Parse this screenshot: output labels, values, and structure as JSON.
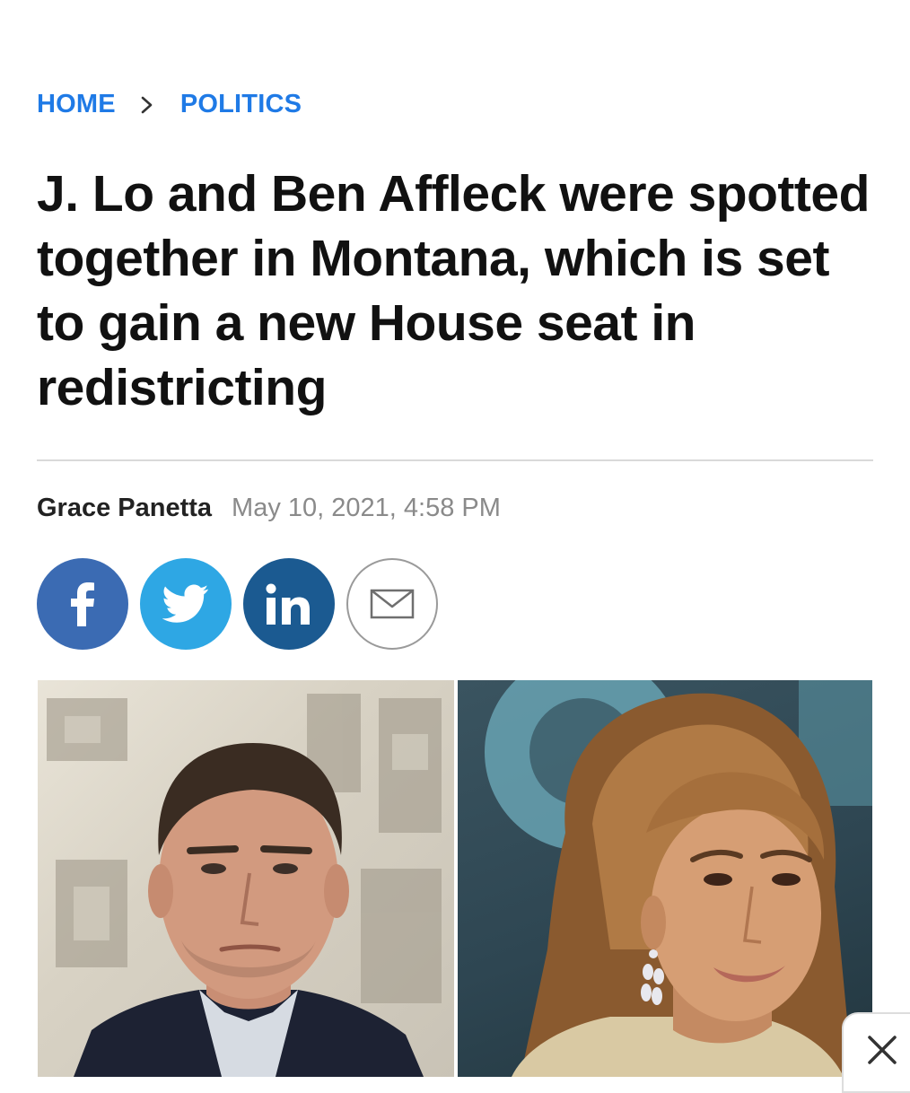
{
  "breadcrumb": {
    "home_label": "HOME",
    "section_label": "POLITICS"
  },
  "article": {
    "headline": "J. Lo and Ben Affleck were spotted together in Montana, which is set to gain a new House seat in redistricting",
    "author": "Grace Panetta",
    "date": "May 10, 2021, 4:58 PM"
  },
  "share": {
    "buttons": [
      "facebook-icon",
      "twitter-icon",
      "linkedin-icon",
      "email-icon"
    ]
  },
  "hero": {
    "left_photo": "photo of Ben Affleck at an event",
    "right_photo": "photo of Jennifer Lopez at an event"
  },
  "icons": {
    "close": "close-icon"
  },
  "colors": {
    "link_blue": "#1f7ae6",
    "facebook": "#3b6bb3",
    "twitter": "#2ea7e4",
    "linkedin": "#1b5a91"
  }
}
